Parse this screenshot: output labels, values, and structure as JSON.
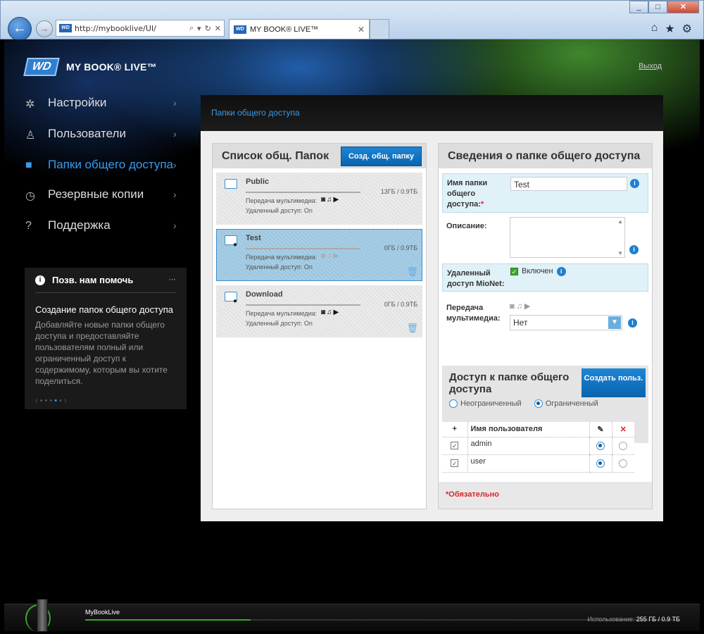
{
  "browser": {
    "url": "http://mybooklive/UI/",
    "tab_title": "MY BOOK® LIVE™",
    "favicon_text": "WD"
  },
  "header": {
    "logo": "WD",
    "brand": "MY BOOK® LIVE™",
    "logout": "Выход"
  },
  "sidebar": {
    "items": [
      {
        "label": "Настройки",
        "icon": "gear-icon"
      },
      {
        "label": "Пользователи",
        "icon": "users-icon"
      },
      {
        "label": "Папки общего доступа",
        "icon": "folder-icon",
        "active": true
      },
      {
        "label": "Резервные копии",
        "icon": "history-icon"
      },
      {
        "label": "Поддержка",
        "icon": "help-icon"
      }
    ]
  },
  "help": {
    "title": "Позв. нам помочь",
    "article_title": "Создание папок общего доступа",
    "article_body": "Добавляйте новые папки общего доступа и предоставляйте пользователям полный или ограниченный доступ к содержимому, которым вы хотите поделиться.",
    "pager_page": 4,
    "pager_total": 5
  },
  "main": {
    "section_title": "Папки общего доступа",
    "list": {
      "title": "Список общ. Папок",
      "create_button": "Созд. общ. папку",
      "media_label": "Передача мультимедиа:",
      "shares": [
        {
          "name": "Public",
          "size": "13ГБ / 0.9ТБ",
          "remote": "Удаленный доступ: On",
          "locked": false,
          "media_on": true,
          "usage_fraction": 0.015
        },
        {
          "name": "Test",
          "size": "0ГБ / 0.9ТБ",
          "remote": "Удаленный доступ: On",
          "locked": true,
          "media_on": false,
          "usage_fraction": 0
        },
        {
          "name": "Download",
          "size": "0ГБ / 0.9ТБ",
          "remote": "Удаленный доступ: On",
          "locked": true,
          "media_on": true,
          "usage_fraction": 0
        }
      ]
    },
    "details": {
      "title": "Сведения о папке общего доступа",
      "name_label": "Имя папки общего доступа:",
      "name_value": "Test",
      "description_label": "Описание:",
      "remote_label": "Удаленный доступ MioNet:",
      "remote_value": "Включен",
      "media_label": "Передача мультимедиа:",
      "media_select": "Нет",
      "access_title": "Доступ к папке общего доступа",
      "create_user_button": "Создать польз.",
      "access_unrestricted": "Неограниченный",
      "access_restricted": "Ограниченный",
      "table_header_user": "Имя пользователя",
      "users": [
        {
          "name": "admin",
          "checked": true,
          "access": "full"
        },
        {
          "name": "user",
          "checked": true,
          "access": "full"
        }
      ],
      "required_note": "*Обязательно"
    }
  },
  "footer": {
    "device_name": "MyBookLive",
    "usage_label": "Использование:",
    "usage_value": "255 ГБ / 0.9 ТБ",
    "usage_fraction": 0.28
  },
  "colors": {
    "accent": "#3a9bea",
    "button": "#0a63ad",
    "green": "#3ca62e",
    "required": "#d9252a"
  }
}
